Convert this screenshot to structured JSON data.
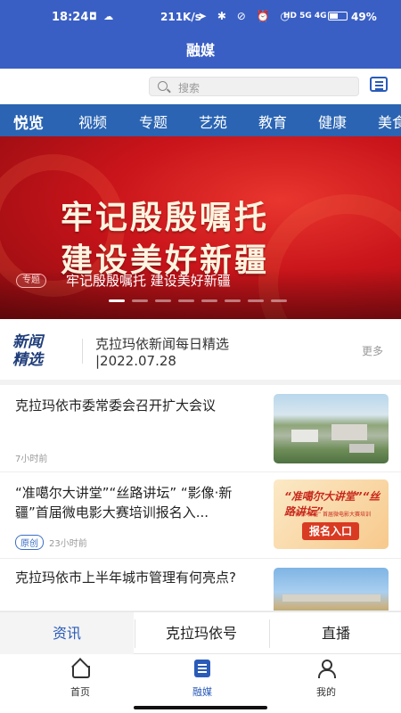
{
  "status_bar": {
    "time": "18:24",
    "left_icons": "◘ ☁",
    "speed": "211K/s",
    "right_icons": "➤ ✱ ⊘ ⏰ ◷",
    "network": "HD 5G 4G",
    "battery_level": 0.49,
    "battery_text": "49%"
  },
  "header": {
    "title": "融媒"
  },
  "search": {
    "placeholder": "搜索"
  },
  "categories": [
    {
      "label": "悦览",
      "active": true
    },
    {
      "label": "视频"
    },
    {
      "label": "专题"
    },
    {
      "label": "艺苑"
    },
    {
      "label": "教育"
    },
    {
      "label": "健康"
    },
    {
      "label": "美食"
    }
  ],
  "banner": {
    "headline_line1": "牢记殷殷嘱托",
    "headline_line2": "建设美好新疆",
    "tag": "专题",
    "caption": "牢记殷殷嘱托 建设美好新疆",
    "slide_count": 8,
    "active_slide": 1
  },
  "featured": {
    "badge_line1": "新闻",
    "badge_line2": "精选",
    "title_line1": "克拉玛依新闻每日精选",
    "title_line2": "|2022.07.28",
    "more": "更多"
  },
  "news": [
    {
      "title": "克拉玛依市委常委会召开扩大会议",
      "time": "7小时前",
      "badge": ""
    },
    {
      "title": "“准噶尔大讲堂”“丝路讲坛” “影像·新疆”首届微电影大赛培训报名入...",
      "time": "23小时前",
      "badge": "原创",
      "thumb_heading": "“准噶尔大讲堂”“丝路讲坛”",
      "thumb_sub": "“影像·新疆” 首届微电影大赛培训",
      "thumb_button": "报名入口"
    },
    {
      "title": "克拉玛依市上半年城市管理有何亮点?",
      "time": "",
      "badge": ""
    }
  ],
  "sub_tabs": [
    {
      "label": "资讯",
      "active": true
    },
    {
      "label": "克拉玛依号"
    },
    {
      "label": "直播"
    }
  ],
  "bottom_nav": [
    {
      "label": "首页",
      "icon": "home-icon"
    },
    {
      "label": "融媒",
      "icon": "media-doc-icon",
      "active": true
    },
    {
      "label": "我的",
      "icon": "user-icon"
    }
  ],
  "colors": {
    "header_blue": "#3a5fc4",
    "nav_blue": "#2a64b3",
    "accent": "#2a5bb8",
    "banner_red": "#c8141a"
  }
}
